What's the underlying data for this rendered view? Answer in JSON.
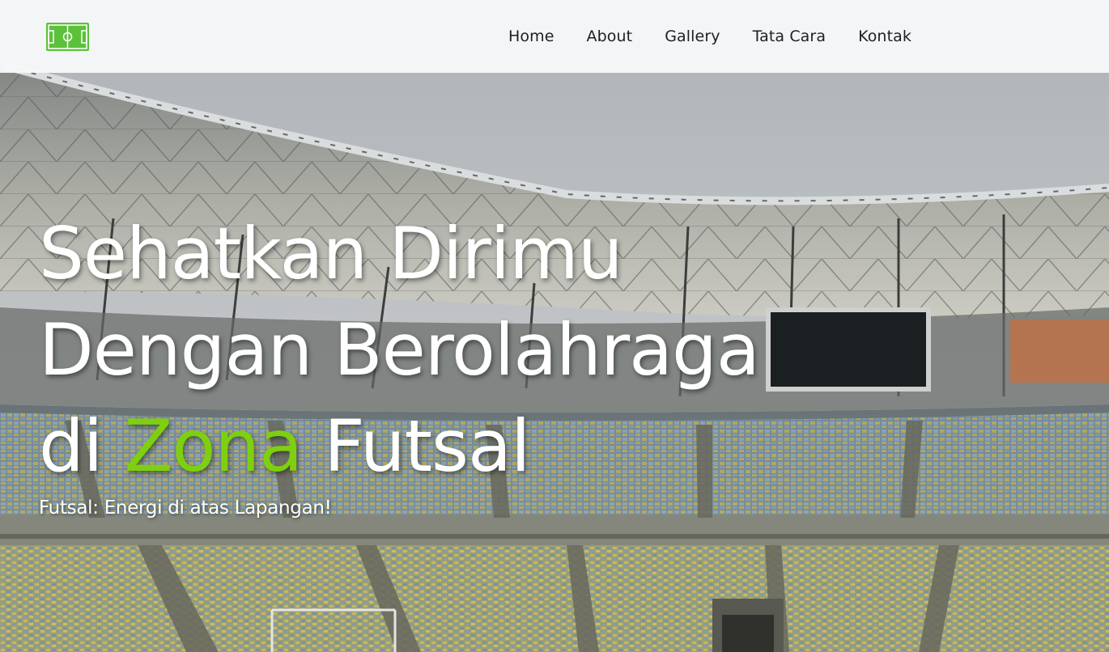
{
  "navbar": {
    "logo_icon": "futsal-field-icon",
    "links": [
      "Home",
      "About",
      "Gallery",
      "Tata Cara",
      "Kontak"
    ]
  },
  "hero": {
    "headline_line1": "Sehatkan Dirimu",
    "headline_line2": "Dengan Berolahraga",
    "headline_line3_prefix": "di ",
    "headline_highlight": "Zona",
    "headline_line3_suffix": " Futsal",
    "tagline": "Futsal: Energi di atas Lapangan!",
    "background_icon": "stadium-background-image"
  },
  "colors": {
    "accent": "#7ed00f",
    "navbar_bg": "#f6f7f9",
    "text_light": "#ffffff",
    "nav_text": "#1f1f1f",
    "logo_green": "#5cc13a"
  }
}
